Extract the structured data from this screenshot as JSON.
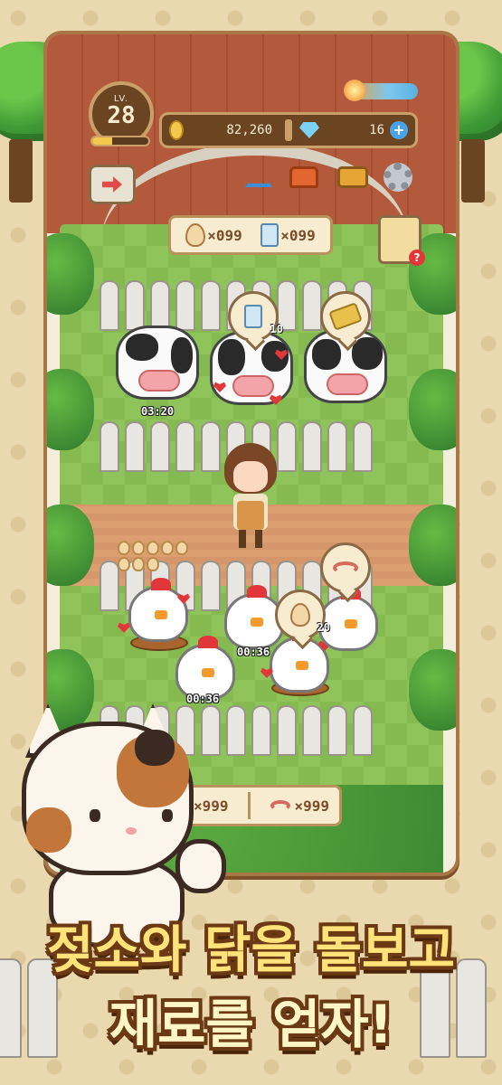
{
  "hud": {
    "level_label": "LV.",
    "level": "28",
    "xp_fraction": 0.35,
    "coins": "82,260",
    "gems": "16",
    "plus_symbol": "+"
  },
  "toolbar": {
    "icons": [
      "exit-farm-icon",
      "hanger-icon",
      "sofa-icon",
      "briefcase-icon",
      "gear-icon"
    ]
  },
  "resources": {
    "eggs": "×099",
    "milk": "×099"
  },
  "quest": {
    "alert": "?"
  },
  "cows": {
    "timer": "03:20",
    "milk_bubble_count": "10"
  },
  "chickens": {
    "timer_1": "00:36",
    "timer_2": "00:36",
    "egg_bubble_count": "20"
  },
  "feed": {
    "hay": "×999",
    "worms": "×999"
  },
  "headline": {
    "line1": "젖소와 닭을 돌보고",
    "line2": "재료를 얻자!"
  },
  "colors": {
    "roof": "#b35a3d",
    "grass": "#8ec45a",
    "frame": "#a97745",
    "headline": "#ffe27a"
  }
}
